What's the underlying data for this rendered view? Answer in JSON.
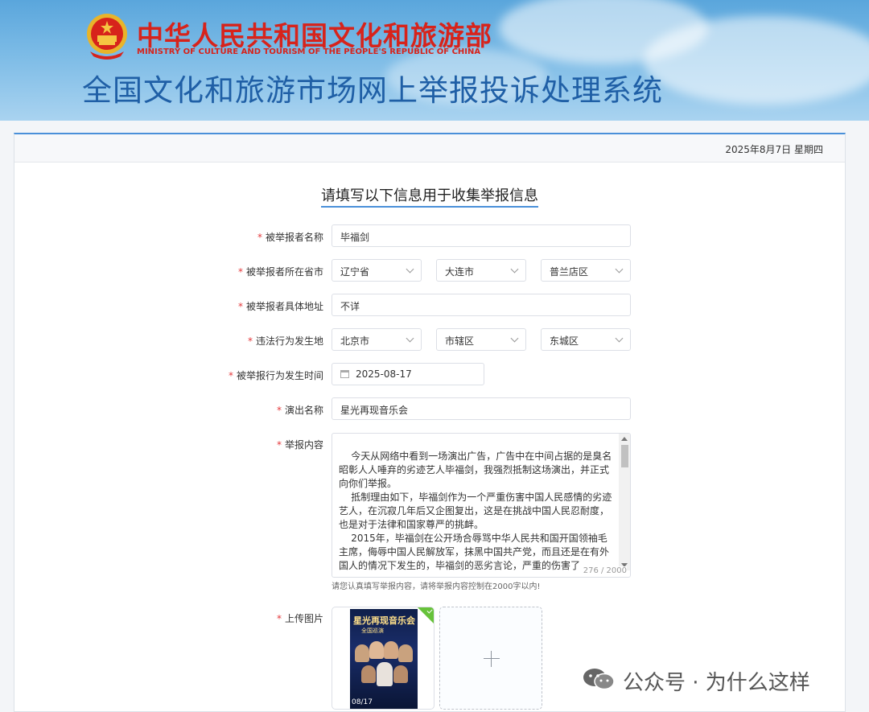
{
  "header": {
    "ministry_cn": "中华人民共和国文化和旅游部",
    "ministry_en": "MINISTRY OF CULTURE AND TOURISM OF THE PEOPLE'S REPUBLIC OF CHINA",
    "system_title": "全国文化和旅游市场网上举报投诉处理系统"
  },
  "date": "2025年8月7日 星期四",
  "form": {
    "title": "请填写以下信息用于收集举报信息",
    "required_mark": "*",
    "reported_name": {
      "label": "被举报者名称",
      "value": "毕福剑"
    },
    "reported_region": {
      "label": "被举报者所在省市",
      "province": "辽宁省",
      "city": "大连市",
      "district": "普兰店区"
    },
    "reported_address": {
      "label": "被举报者具体地址",
      "value": "不详"
    },
    "violation_place": {
      "label": "违法行为发生地",
      "province": "北京市",
      "city": "市辖区",
      "district": "东城区"
    },
    "violation_time": {
      "label": "被举报行为发生时间",
      "value": "2025-08-17"
    },
    "show_name": {
      "label": "演出名称",
      "value": "星光再现音乐会"
    },
    "content": {
      "label": "举报内容",
      "value": "    今天从网络中看到一场演出广告，广告中在中间占据的是臭名昭彰人人唾弃的劣迹艺人毕福剑，我强烈抵制这场演出，并正式向你们举报。\n    抵制理由如下，毕福剑作为一个严重伤害中国人民感情的劣迹艺人，在沉寂几年后又企图复出，这是在挑战中国人民忍耐度，也是对于法律和国家尊严的挑衅。\n    2015年，毕福剑在公开场合辱骂中华人民共和国开国领袖毛主席，侮辱中国人民解放军，抹黑中国共产党，而且还是在有外国人的情况下发生的，毕福剑的恶劣言论，严重的伤害了",
      "counter": "276 / 2000",
      "hint": "请您认真填写举报内容，请将举报内容控制在2000字以内!"
    },
    "upload": {
      "label": "上传图片",
      "poster_title": "星光再现音乐会",
      "poster_sub": "全国巡演",
      "poster_date": "08/17 "
    }
  },
  "watermark": {
    "text": "公众号 · 为什么这样"
  },
  "colors": {
    "accent": "#4a90d9",
    "ministry_red": "#d7231b",
    "title_blue": "#1f5fa6",
    "required": "#e4393c",
    "success": "#67c23a"
  }
}
